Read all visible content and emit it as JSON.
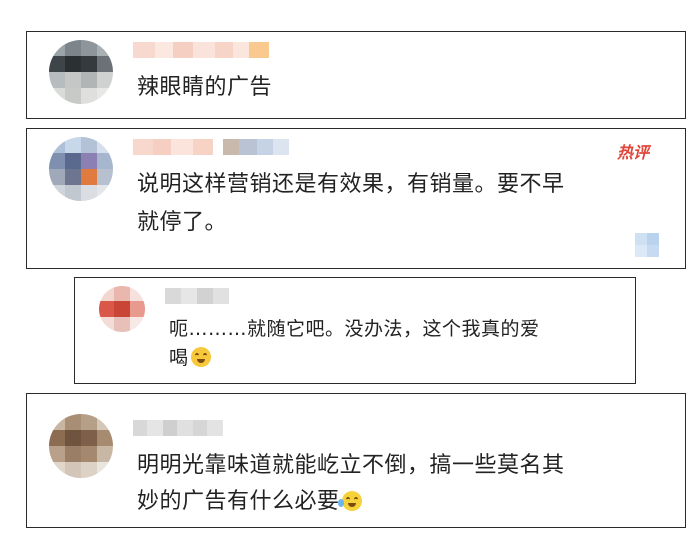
{
  "comments": [
    {
      "text": "辣眼睛的广告"
    },
    {
      "text_line1": "说明这样营销还是有效果，有销量。要不早",
      "text_line2": "就停了。",
      "tag": "热评"
    },
    {
      "text_line1": "呃………就随它吧。没办法，这个我真的爱",
      "text_line2": "喝"
    },
    {
      "text_line1": "明明光靠味道就能屹立不倒，搞一些莫名其",
      "text_line2": "妙的广告有什么必要"
    }
  ],
  "icons": [
    "avatar-blurred",
    "username-blurred",
    "smiling-emoji-icon",
    "laughing-crying-emoji-icon"
  ],
  "colors": {
    "border": "#2b2b2b",
    "hot_tag": "#e0463a",
    "text": "#222222"
  }
}
